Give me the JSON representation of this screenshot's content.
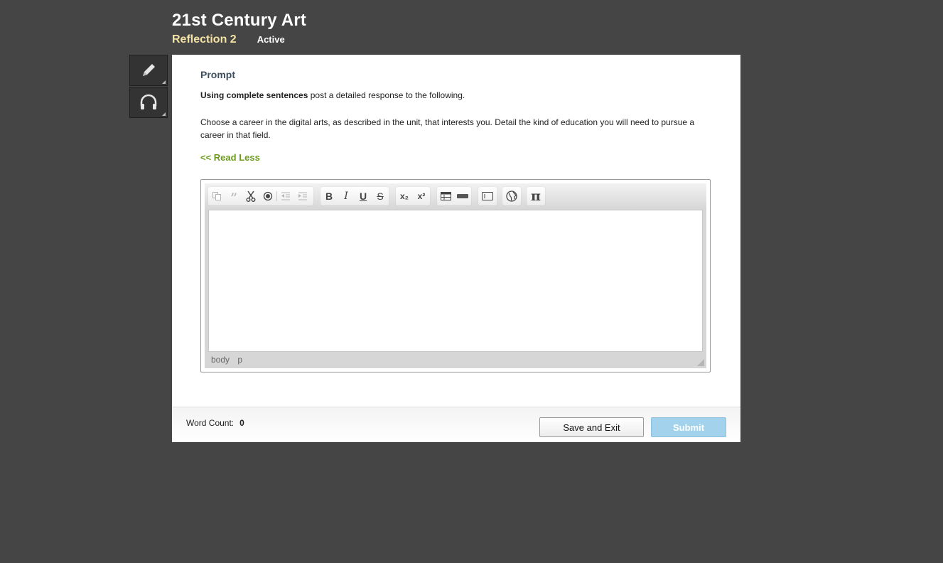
{
  "header": {
    "course_title": "21st Century Art",
    "activity_name": "Reflection 2",
    "status": "Active"
  },
  "toolbox": {
    "items": [
      {
        "icon": "pencil-icon"
      },
      {
        "icon": "headphones-icon"
      }
    ]
  },
  "prompt": {
    "heading": "Prompt",
    "line1_bold": "Using complete sentences",
    "line1_rest": " post a detailed response to the following.",
    "body": "Choose a career in the digital arts, as described in the unit, that interests you. Detail the kind of education you will need to pursue a career in that field.",
    "read_less": "<< Read Less"
  },
  "editor": {
    "toolbar_icons": [
      "copy-icon",
      "blockquote-icon",
      "cut-icon",
      "record-icon",
      "outdent-icon",
      "indent-icon",
      "bold-icon",
      "italic-icon",
      "underline-icon",
      "strikethrough-icon",
      "subscript-icon",
      "superscript-icon",
      "table-icon",
      "horizontal-rule-icon",
      "text-field-icon",
      "globe-icon",
      "pi-icon"
    ],
    "labels": {
      "bold": "B",
      "italic": "I",
      "underline": "U",
      "strike": "S",
      "sub": "x₂",
      "sup": "x²",
      "pi": "π"
    },
    "content": "",
    "status_path": [
      "body",
      "p"
    ]
  },
  "footer": {
    "word_count_label": "Word Count:",
    "word_count_value": "0",
    "save_label": "Save and Exit",
    "submit_label": "Submit"
  },
  "colors": {
    "background": "#454545",
    "activity_name": "#f4e3a6",
    "link_green": "#6b9a1f",
    "submit_bg": "#a3d2ec"
  }
}
